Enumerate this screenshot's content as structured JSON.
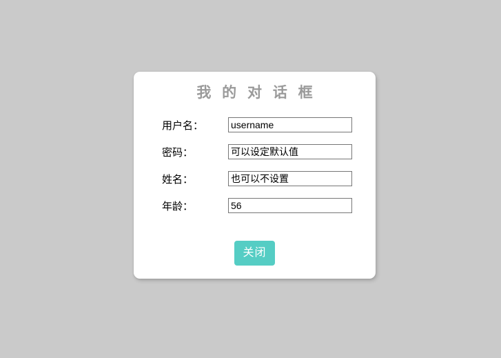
{
  "page": {
    "background_color": "#cacaca"
  },
  "dialog": {
    "title": "我 的 对 话 框",
    "title_color": "#9a9a9a",
    "background_color": "#ffffff",
    "fields": [
      {
        "label": "用户名：",
        "value": "username",
        "placeholder": "username",
        "name": "username"
      },
      {
        "label": "密码：",
        "value": "可以设定默认值",
        "placeholder": "可以设定默认值",
        "name": "password"
      },
      {
        "label": "姓名：",
        "value": "也可以不设置",
        "placeholder": "也可以不设置",
        "name": "fullname"
      },
      {
        "label": "年龄：",
        "value": "56",
        "placeholder": "56",
        "name": "age"
      }
    ],
    "footer": {
      "close_label": "关闭",
      "close_color": "#55cdc4"
    }
  }
}
